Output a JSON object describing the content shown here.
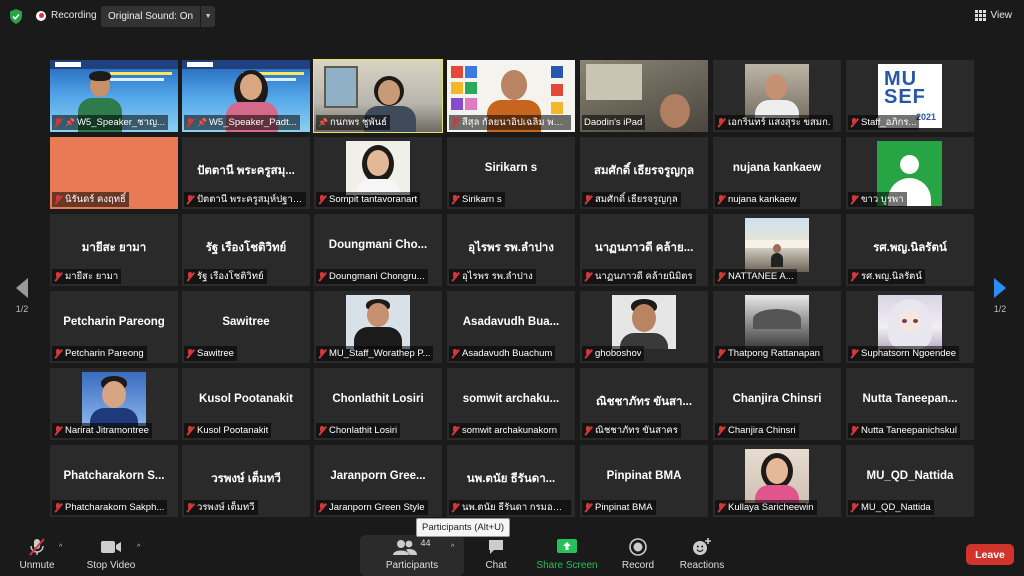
{
  "topbar": {
    "recording_label": "Recording",
    "original_sound_label": "Original Sound: On",
    "view_label": "View"
  },
  "pager": {
    "left_page": "1/2",
    "right_page": "1/2"
  },
  "tiles": [
    {
      "label": "W5_Speaker_ชาญ...",
      "center": ""
    },
    {
      "label": "W5_Speaker_Padt...",
      "center": ""
    },
    {
      "label": "กนกพร ชูพันธ์",
      "center": ""
    },
    {
      "label": "สีสุล กัลยนาอิปเฉลิม พระ...",
      "center": ""
    },
    {
      "label": "Daodin's iPad",
      "center": ""
    },
    {
      "label": "เอกรินทร์ แสงสุระ ขสมก.",
      "center": ""
    },
    {
      "label": "Staff_อภิกร...",
      "center": ""
    },
    {
      "label": "นิรันดร์ คงฤทธิ์",
      "center": ""
    },
    {
      "label": "ปัตตานี พระครูสมุห์ปฐาพ...",
      "center": "ปัตตานี พระครูสมุ..."
    },
    {
      "label": "Sompit tantavoranart",
      "center": ""
    },
    {
      "label": "Sirikarn s",
      "center": "Sirikarn s"
    },
    {
      "label": "สมศักดิ์ เธียรจรูญกุล",
      "center": "สมศักดิ์ เธียรจรูญกุล"
    },
    {
      "label": "nujana   kankaew",
      "center": "nujana   kankaew"
    },
    {
      "label": "ขาว บูรพา",
      "center": ""
    },
    {
      "label": "มายีสะ ยามา",
      "center": "มายีสะ ยามา"
    },
    {
      "label": "รัฐ เรืองโชติวิทย์",
      "center": "รัฐ เรืองโชติวิทย์"
    },
    {
      "label": "Doungmani Chongru...",
      "center": "Doungmani  Cho..."
    },
    {
      "label": "อุไรพร  รพ.ลำปาง",
      "center": "อุไรพร  รพ.ลำปาง"
    },
    {
      "label": "นาฏนภาวดี คล้ายนิมิตร",
      "center": "นาฏนภาวดี คล้าย..."
    },
    {
      "label": "NATTANEE A...",
      "center": ""
    },
    {
      "label": "รศ.พญ.นิลรัตน์",
      "center": "รศ.พญ.นิลรัตน์"
    },
    {
      "label": "Petcharin Pareong",
      "center": "Petcharin Pareong"
    },
    {
      "label": "Sawitree",
      "center": "Sawitree"
    },
    {
      "label": "MU_Staff_Worathep P...",
      "center": ""
    },
    {
      "label": "Asadavudh Buachum",
      "center": "Asadavudh  Bua..."
    },
    {
      "label": "ghoboshov",
      "center": ""
    },
    {
      "label": "Thatpong Rattanapan",
      "center": ""
    },
    {
      "label": "Suphatsorn Ngoendee",
      "center": ""
    },
    {
      "label": "Narirat Jitramontree",
      "center": ""
    },
    {
      "label": "Kusol Pootanakit",
      "center": "Kusol Pootanakit"
    },
    {
      "label": "Chonlathit Losiri",
      "center": "Chonlathit Losiri"
    },
    {
      "label": "somwit archakunakorn",
      "center": "somwit  archaku..."
    },
    {
      "label": "ณิชชาภัทร ขันสาคร",
      "center": "ณิชชาภัทร ขันสา..."
    },
    {
      "label": "Chanjira Chinsri",
      "center": "Chanjira Chinsri"
    },
    {
      "label": "Nutta Taneepanichskul",
      "center": "Nutta  Taneepan..."
    },
    {
      "label": "Phatcharakorn Sakph...",
      "center": "Phatcharakorn  S..."
    },
    {
      "label": "วรพงษ์ เต็มทวี",
      "center": "วรพงษ์ เต็มทวี"
    },
    {
      "label": "Jaranporn Green Style",
      "center": "Jaranporn  Gree..."
    },
    {
      "label": "นพ.ตนัย ธีรันดา กรมอนา...",
      "center": "นพ.ตนัย ธีรันดา..."
    },
    {
      "label": "Pinpinat BMA",
      "center": "Pinpinat BMA"
    },
    {
      "label": "Kullaya Saricheewin",
      "center": ""
    },
    {
      "label": "MU_QD_Nattida",
      "center": "MU_QD_Nattida"
    }
  ],
  "logo_text": {
    "line1": "MU",
    "line2": "SEF",
    "year": "2021"
  },
  "tooltip": "Participants (Alt+U)",
  "toolbar": {
    "unmute": "Unmute",
    "stop_video": "Stop Video",
    "participants": "Participants",
    "participant_count": "44",
    "chat": "Chat",
    "share_screen": "Share Screen",
    "record": "Record",
    "reactions": "Reactions",
    "leave": "Leave"
  },
  "colors": {
    "accent": "#2d8cff",
    "leave": "#d2332b",
    "share_green": "#27c05a",
    "muted_red": "#d23838",
    "highlight": "#e6e45a"
  }
}
